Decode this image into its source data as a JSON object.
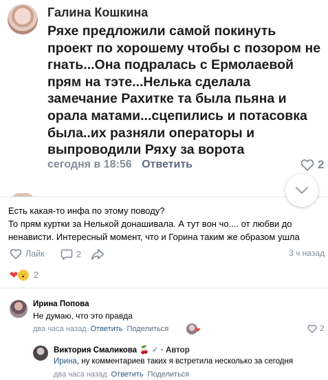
{
  "top_comment": {
    "author": "Галина Кошкина",
    "text": "Ряхе предложили самой покинуть проект по хорошему чтобы с позором не гнать...Она подралась с Ермолаевой прям на тэте...Нелька сделала замечание Рахитке та была пьяна и орала матами...сцепились и потасовка была..их разняли операторы и выпроводили Ряху за ворота",
    "time": "сегодня в 18:56",
    "reply_label": "Ответить",
    "likes": "2"
  },
  "post": {
    "text_line1": "Есть какая-то инфа по этому поводу?",
    "text_line2": "То прям куртки за Нелькой донашивала. А тут вон чо.... от любви до ненависти. Интересный момент, что и Горина таким же образом ушла",
    "like_label": "Лайк",
    "comments_count": "2",
    "time": "3 ч назад",
    "reactions_count": "2"
  },
  "comments": [
    {
      "author": "Ирина Попова",
      "text": "Не думаю, что это правда",
      "time": "два часа назад",
      "reply_label": "Ответить",
      "share_label": "Поделиться",
      "likes": "2"
    },
    {
      "author": "Виктория Смаликова",
      "badge": "· Автор",
      "mention": "Ирина",
      "text": ", ну комментариев таких я встретила несколько за сегодня",
      "time": "два часа назад",
      "reply_label": "Ответить",
      "share_label": "Поделиться"
    }
  ],
  "colors": {
    "link": "#2a5885",
    "secondary": "#818c99",
    "heart": "#e64646",
    "divider": "#e7e8ec"
  },
  "icons": [
    "heart-outline-icon",
    "comment-icon",
    "share-icon",
    "chevron-down-icon",
    "heart-reaction-icon",
    "wow-reaction-icon",
    "cherry-icon",
    "verified-icon"
  ]
}
